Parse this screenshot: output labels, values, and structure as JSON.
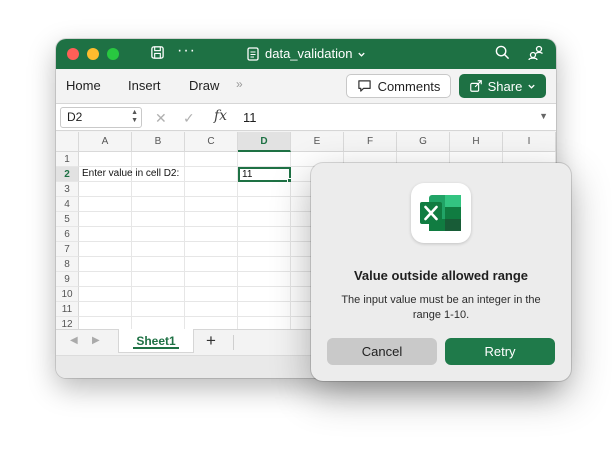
{
  "window": {
    "file_name": "data_validation",
    "icons": [
      "close-traffic-light",
      "minimize-traffic-light",
      "zoom-traffic-light",
      "save-icon",
      "more-icon",
      "search-icon",
      "collaborate-icon"
    ]
  },
  "ribbon": {
    "tabs": [
      "Home",
      "Insert",
      "Draw"
    ],
    "more": "»",
    "comments_label": "Comments",
    "share_label": "Share"
  },
  "formula_bar": {
    "name_box": "D2",
    "fx_label": "fx",
    "value": "11"
  },
  "grid": {
    "columns": [
      "A",
      "B",
      "C",
      "D",
      "E",
      "F",
      "G",
      "H",
      "I"
    ],
    "rows": [
      "1",
      "2",
      "3",
      "4",
      "5",
      "6",
      "7",
      "8",
      "9",
      "10",
      "11",
      "12"
    ],
    "selected_column": "D",
    "selected_row": "2",
    "cells": {
      "A2": "Enter value in cell D2:",
      "D2": "11"
    }
  },
  "sheets": {
    "tabs": [
      "Sheet1"
    ],
    "add_label": "+"
  },
  "colors": {
    "brand_green": "#1e7144",
    "retry_green": "#1f7a4a"
  },
  "dialog": {
    "icon": "excel-app-icon",
    "title": "Value outside allowed range",
    "message": "The input value must be an integer in the range 1-10.",
    "cancel_label": "Cancel",
    "retry_label": "Retry"
  }
}
